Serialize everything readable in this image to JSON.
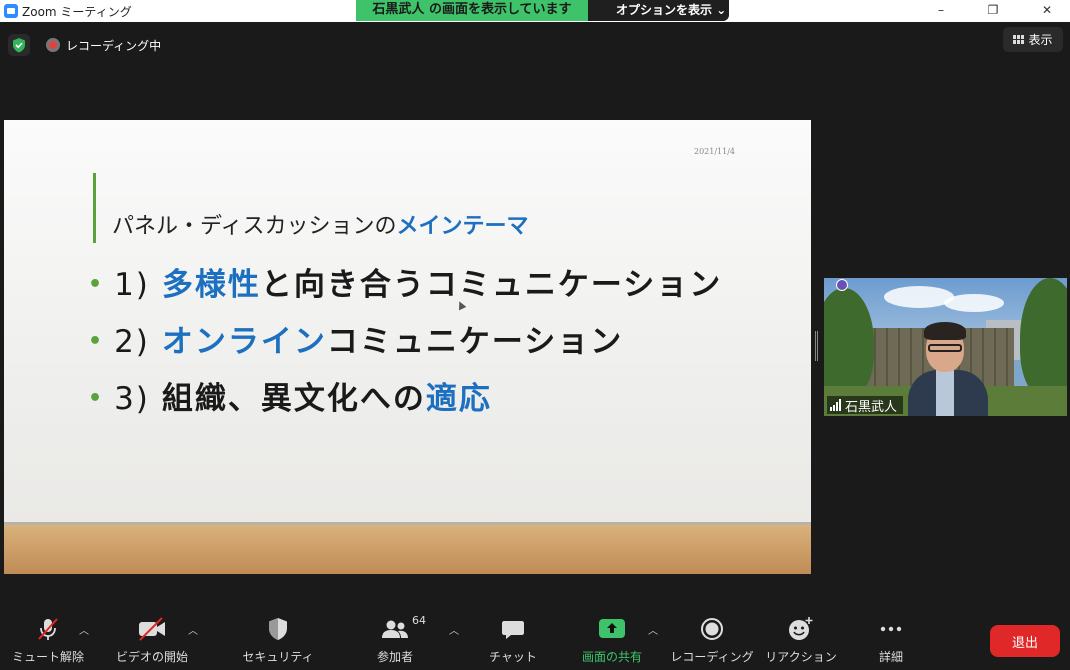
{
  "window": {
    "title": "Zoom ミーティング",
    "controls": [
      "–",
      "❐",
      "✕"
    ]
  },
  "share_banner": {
    "text": "石黒武人 の画面を表示しています",
    "options_label": "オプションを表示"
  },
  "status": {
    "recording_label": "レコーディング中",
    "view_label": "表示"
  },
  "slide": {
    "date": "2021/11/4",
    "title_plain": "パネル・ディスカッションの",
    "title_highlight": "メインテーマ",
    "items": [
      {
        "num": "1)",
        "highlight": "多様性",
        "rest": "と向き合うコミュニケーション"
      },
      {
        "num": "2)",
        "highlight": "オンライン",
        "rest": "コミュニケーション"
      },
      {
        "num": "3)",
        "plain": "組織、異文化への",
        "highlight": "適応"
      }
    ],
    "accent_color": "#1d6fc0",
    "bullet_color": "#5aa23c"
  },
  "participant": {
    "name": "石黒武人"
  },
  "toolbar": {
    "mute": "ミュート解除",
    "video": "ビデオの開始",
    "security": "セキュリティ",
    "participants": "参加者",
    "participants_count": "64",
    "chat": "チャット",
    "share": "画面の共有",
    "record": "レコーディング",
    "reactions": "リアクション",
    "more": "詳細",
    "leave": "退出"
  },
  "colors": {
    "share_green": "#3ec36a",
    "leave_red": "#e02828"
  }
}
